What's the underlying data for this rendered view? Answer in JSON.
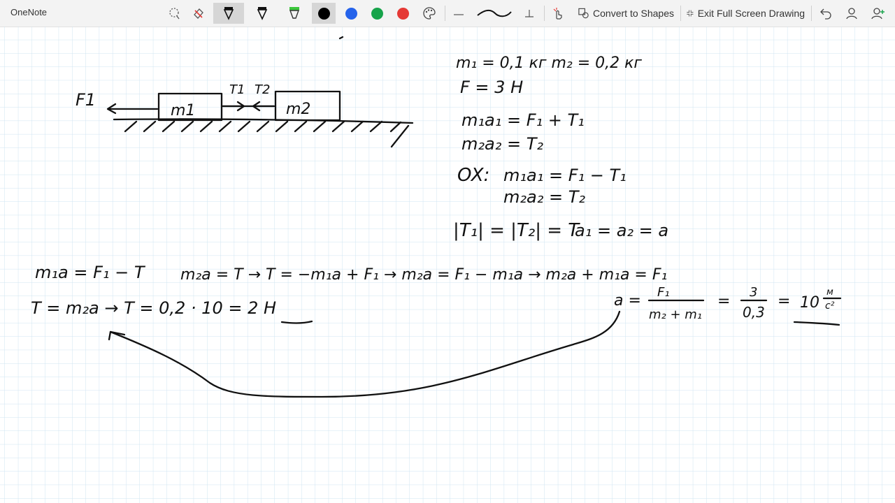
{
  "window": {
    "app_name": "OneNote"
  },
  "toolbar": {
    "convert_label": "Convert to Shapes",
    "exit_label": "Exit Full Screen Drawing",
    "pen_colors": [
      "#000000",
      "#2563eb",
      "#16a34a",
      "#e53935"
    ],
    "selected_color": "#000000"
  },
  "canvas": {
    "grid_color": "#cfe4f2",
    "ink_color": "#111111",
    "accent_red": "#e53935",
    "accent_blue": "#2563eb",
    "diagram": {
      "force_label": "F1",
      "block1_label": "m1",
      "block2_label": "m2",
      "tension1_label": "T1",
      "tension2_label": "T2"
    },
    "given": {
      "masses": "m₁ = 0,1 кг     m₂ = 0,2 кг",
      "force": "F = 3 H"
    },
    "equations": {
      "vec1": "m₁a₁ = F₁ + T₁",
      "vec2": "m₂a₂ = T₂",
      "ox_label": "OX:",
      "ox1": "m₁a₁ = F₁ − T₁",
      "ox2": "m₂a₂ = T₂",
      "tension_eq": "|T₁| = |T₂| = T",
      "accel_eq": "a₁ = a₂ = a"
    },
    "solution": {
      "line1a": "m₁a = F₁ − T",
      "line1b": "m₂a = T  →  T = −m₁a + F₁  →  m₂a = F₁ − m₁a  →  m₂a + m₁a = F₁",
      "line2a": "T = m₂a  →  T = 0,2 · 10 = ",
      "t_result": "2 H",
      "a_prefix": "a =",
      "a_numer": "F₁",
      "a_denom": "m₂ + m₁",
      "eq1": "=",
      "num3": "3",
      "den03": "0,3",
      "eq2": "=",
      "a_result": "10",
      "unit_top": "м",
      "unit_bottom": "с²"
    }
  }
}
